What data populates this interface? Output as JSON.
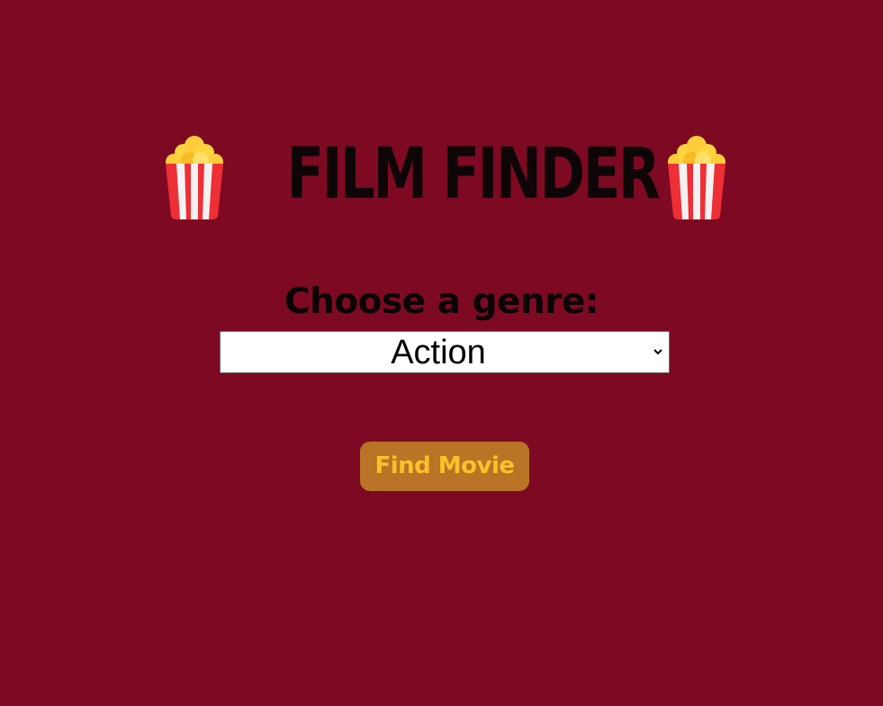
{
  "header": {
    "title": "FILM FINDER",
    "left_icon": "popcorn-icon",
    "right_icon": "popcorn-icon"
  },
  "genre": {
    "label": "Choose a genre:",
    "selected": "Action"
  },
  "find_button": {
    "label": "Find Movie"
  },
  "colors": {
    "background": "#7d0a22",
    "title_text": "#0e0507",
    "button_background": "#b97425",
    "button_text": "#fcc02a"
  }
}
